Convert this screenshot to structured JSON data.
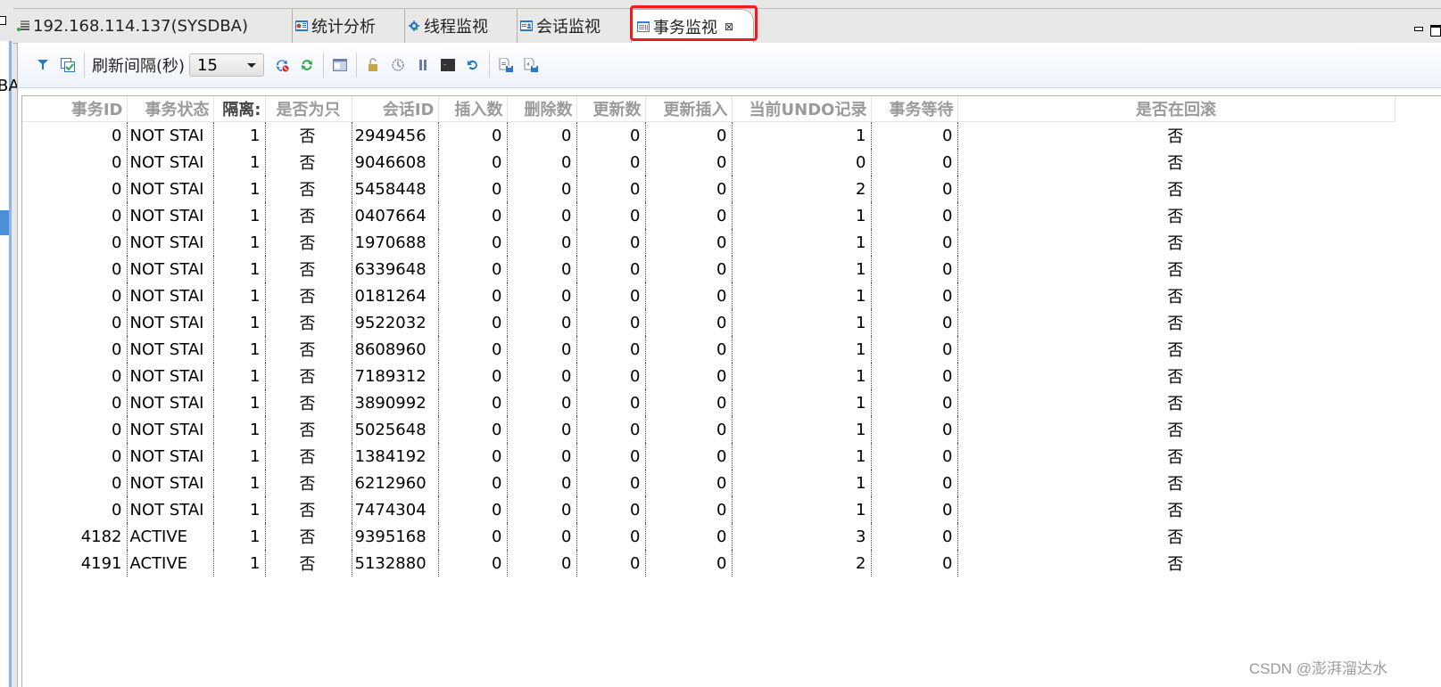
{
  "left_panel": {
    "fragment_text": "BA"
  },
  "tabs": [
    {
      "label": "192.168.114.137(SYSDBA)",
      "icon": "database-connection-icon",
      "active": false
    },
    {
      "label": "统计分析",
      "icon": "statistics-chart-icon",
      "active": false
    },
    {
      "label": "线程监视",
      "icon": "gear-play-icon",
      "active": false
    },
    {
      "label": "会话监视",
      "icon": "session-card-icon",
      "active": false
    },
    {
      "label": "事务监视",
      "icon": "transaction-list-icon",
      "active": true,
      "close_icon": "⊠"
    }
  ],
  "highlight_color": "#ee1c1c",
  "toolbar": {
    "refresh_interval_label": "刷新间隔(秒)",
    "refresh_interval_value": "15",
    "icons": [
      "filter-icon",
      "select-columns-icon",
      "stop-refresh-icon",
      "refresh-icon",
      "grid-view-icon",
      "unlock-icon",
      "history-icon",
      "pause-icon",
      "terminal-icon",
      "undo-icon",
      "export-icon",
      "export-as-icon"
    ]
  },
  "table": {
    "columns": [
      "事务ID",
      "事务状态",
      "隔离:",
      "是否为只",
      "会话ID",
      "插入数",
      "删除数",
      "更新数",
      "更新插入",
      "当前UNDO记录",
      "事务等待",
      "是否在回滚"
    ],
    "rows": [
      [
        "0",
        "NOT STAI",
        "1",
        "否",
        "2949456",
        "0",
        "0",
        "0",
        "0",
        "1",
        "0",
        "否"
      ],
      [
        "0",
        "NOT STAI",
        "1",
        "否",
        "9046608",
        "0",
        "0",
        "0",
        "0",
        "0",
        "0",
        "否"
      ],
      [
        "0",
        "NOT STAI",
        "1",
        "否",
        "5458448",
        "0",
        "0",
        "0",
        "0",
        "2",
        "0",
        "否"
      ],
      [
        "0",
        "NOT STAI",
        "1",
        "否",
        "0407664",
        "0",
        "0",
        "0",
        "0",
        "1",
        "0",
        "否"
      ],
      [
        "0",
        "NOT STAI",
        "1",
        "否",
        "1970688",
        "0",
        "0",
        "0",
        "0",
        "1",
        "0",
        "否"
      ],
      [
        "0",
        "NOT STAI",
        "1",
        "否",
        "6339648",
        "0",
        "0",
        "0",
        "0",
        "1",
        "0",
        "否"
      ],
      [
        "0",
        "NOT STAI",
        "1",
        "否",
        "0181264",
        "0",
        "0",
        "0",
        "0",
        "1",
        "0",
        "否"
      ],
      [
        "0",
        "NOT STAI",
        "1",
        "否",
        "9522032",
        "0",
        "0",
        "0",
        "0",
        "1",
        "0",
        "否"
      ],
      [
        "0",
        "NOT STAI",
        "1",
        "否",
        "8608960",
        "0",
        "0",
        "0",
        "0",
        "1",
        "0",
        "否"
      ],
      [
        "0",
        "NOT STAI",
        "1",
        "否",
        "7189312",
        "0",
        "0",
        "0",
        "0",
        "1",
        "0",
        "否"
      ],
      [
        "0",
        "NOT STAI",
        "1",
        "否",
        "3890992",
        "0",
        "0",
        "0",
        "0",
        "1",
        "0",
        "否"
      ],
      [
        "0",
        "NOT STAI",
        "1",
        "否",
        "5025648",
        "0",
        "0",
        "0",
        "0",
        "1",
        "0",
        "否"
      ],
      [
        "0",
        "NOT STAI",
        "1",
        "否",
        "1384192",
        "0",
        "0",
        "0",
        "0",
        "1",
        "0",
        "否"
      ],
      [
        "0",
        "NOT STAI",
        "1",
        "否",
        "6212960",
        "0",
        "0",
        "0",
        "0",
        "1",
        "0",
        "否"
      ],
      [
        "0",
        "NOT STAI",
        "1",
        "否",
        "7474304",
        "0",
        "0",
        "0",
        "0",
        "1",
        "0",
        "否"
      ],
      [
        "4182",
        "ACTIVE",
        "1",
        "否",
        "9395168",
        "0",
        "0",
        "0",
        "0",
        "3",
        "0",
        "否"
      ],
      [
        "4191",
        "ACTIVE",
        "1",
        "否",
        "5132880",
        "0",
        "0",
        "0",
        "0",
        "2",
        "0",
        "否"
      ]
    ]
  },
  "watermark": "CSDN @澎湃溜达水"
}
